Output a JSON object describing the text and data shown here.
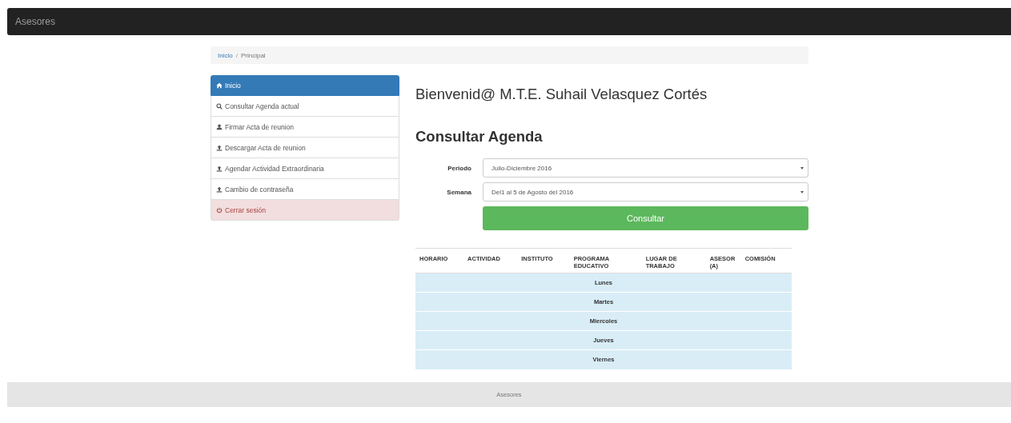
{
  "navbar": {
    "brand": "Asesores"
  },
  "breadcrumb": [
    {
      "label": "Inicio",
      "link": true
    },
    {
      "label": "Principal",
      "link": false
    }
  ],
  "breadcrumb_separator": "/",
  "sidebar": {
    "items": [
      {
        "label": "Inicio",
        "kind": "home",
        "selected": true,
        "danger": false
      },
      {
        "label": "Consultar Agenda actual",
        "kind": "search",
        "selected": false,
        "danger": false
      },
      {
        "label": "Firmar Acta de reunion",
        "kind": "user",
        "selected": false,
        "danger": false
      },
      {
        "label": "Descargar Acta de reunion",
        "kind": "upload",
        "selected": false,
        "danger": false
      },
      {
        "label": "Agendar Actividad Extraordinaria",
        "kind": "upload",
        "selected": false,
        "danger": false
      },
      {
        "label": "Cambio de contraseña",
        "kind": "upload",
        "selected": false,
        "danger": false
      },
      {
        "label": "Cerrar sesión",
        "kind": "power",
        "selected": false,
        "danger": true
      }
    ]
  },
  "welcome": "Bienvenid@ M.T.E. Suhail Velasquez Cortés",
  "section_title": "Consultar Agenda",
  "form": {
    "fields": [
      {
        "label": "Periodo",
        "value": "Julio-Diciembre 2016"
      },
      {
        "label": "Semana",
        "value": "Del1 al 5 de Agosto del 2016"
      }
    ],
    "submit": "Consultar"
  },
  "table": {
    "columns": [
      "HORARIO",
      "ACTIVIDAD",
      "INSTITUTO",
      "PROGRAMA EDUCATIVO",
      "LUGAR DE TRABAJO",
      "ASESOR (A)",
      "COMISIÓN"
    ],
    "rows": [
      "Lunes",
      "Martes",
      "Miercoles",
      "Jueves",
      "Viernes"
    ]
  },
  "footer": "Asesores"
}
